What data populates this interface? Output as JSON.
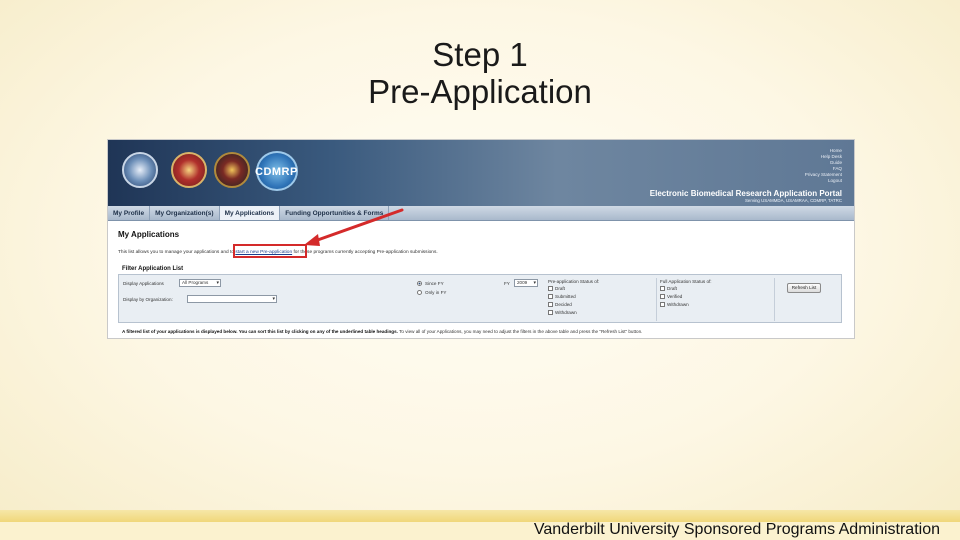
{
  "slide": {
    "title_line1": "Step 1",
    "title_line2": "Pre-Application",
    "footer": "Vanderbilt University Sponsored Programs Administration"
  },
  "screenshot": {
    "banner": {
      "logo_text": "CDMRP",
      "top_links": [
        "Home",
        "Help Desk",
        "Guide",
        "FAQ",
        "Privacy Statement",
        "Logout"
      ],
      "portal_title": "Electronic Biomedical Research Application Portal",
      "portal_subtitle": "Serving USAMMDA, USAMRAA, CDMRP, TATRC"
    },
    "nav": {
      "tabs": [
        "My Profile",
        "My Organization(s)",
        "My Applications",
        "Funding Opportunities & Forms"
      ],
      "active_tab": "My Applications"
    },
    "page_heading": "My Applications",
    "intro": {
      "before": "This list allows you to manage your applications and to ",
      "link": "start a new Pre-application",
      "after": " for those programs currently accepting Pre-application submissions."
    },
    "filter": {
      "heading": "Filter Application List",
      "display_applications_label": "Display Applications",
      "display_applications_value": "All Programs",
      "display_by_org_label": "Display by Organization:",
      "display_by_org_value": "",
      "radio_since": "Since FY",
      "radio_only": "Only in FY",
      "fy_label": "FY",
      "fy_value": "2009",
      "pre_status_heading": "Pre-application Status of:",
      "pre_status_options": [
        "Draft",
        "Submitted",
        "Decided",
        "Withdrawn"
      ],
      "full_status_heading": "Full Application Status of:",
      "full_status_options": [
        "Draft",
        "Verified",
        "Withdrawn"
      ],
      "refresh_button": "Refresh List"
    },
    "note": {
      "bold": "A filtered list of your applications is displayed below. You can sort this list by clicking on any of the underlined table headings.",
      "rest": " To view all of your Applications, you may need to adjust the filters in the above table and press the \"Refresh List\" button."
    },
    "colors": {
      "highlight_red": "#d42a2a",
      "banner_blue": "#1f3556"
    }
  }
}
